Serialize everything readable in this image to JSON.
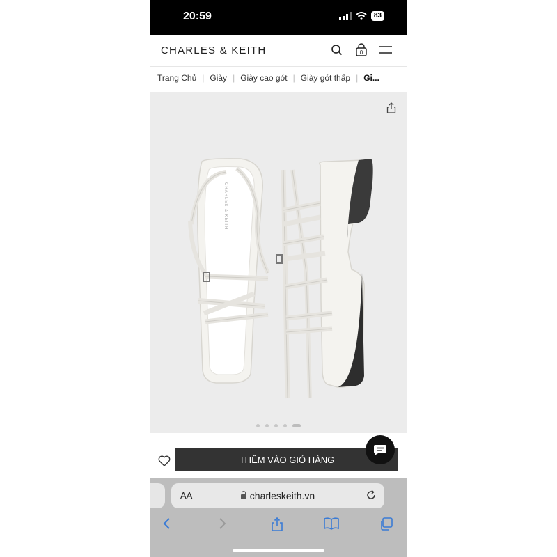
{
  "status_bar": {
    "time": "20:59",
    "battery": "83"
  },
  "header": {
    "brand": "CHARLES & KEITH",
    "cart_count": "0"
  },
  "breadcrumb": [
    "Trang Chủ",
    "Giày",
    "Giày cao gót",
    "Giày gót thấp",
    "Gi..."
  ],
  "product_image": {
    "brand_on_insole": "CHARLES & KEITH",
    "total_images": 5,
    "active_index": 5
  },
  "actions": {
    "add_to_cart": "THÊM VÀO GIỎ HÀNG"
  },
  "browser": {
    "text_size": "AA",
    "url": "charleskeith.vn"
  },
  "colors": {
    "button_bg": "#333333",
    "link_blue": "#3a7bd5",
    "image_bg": "#ececec"
  }
}
